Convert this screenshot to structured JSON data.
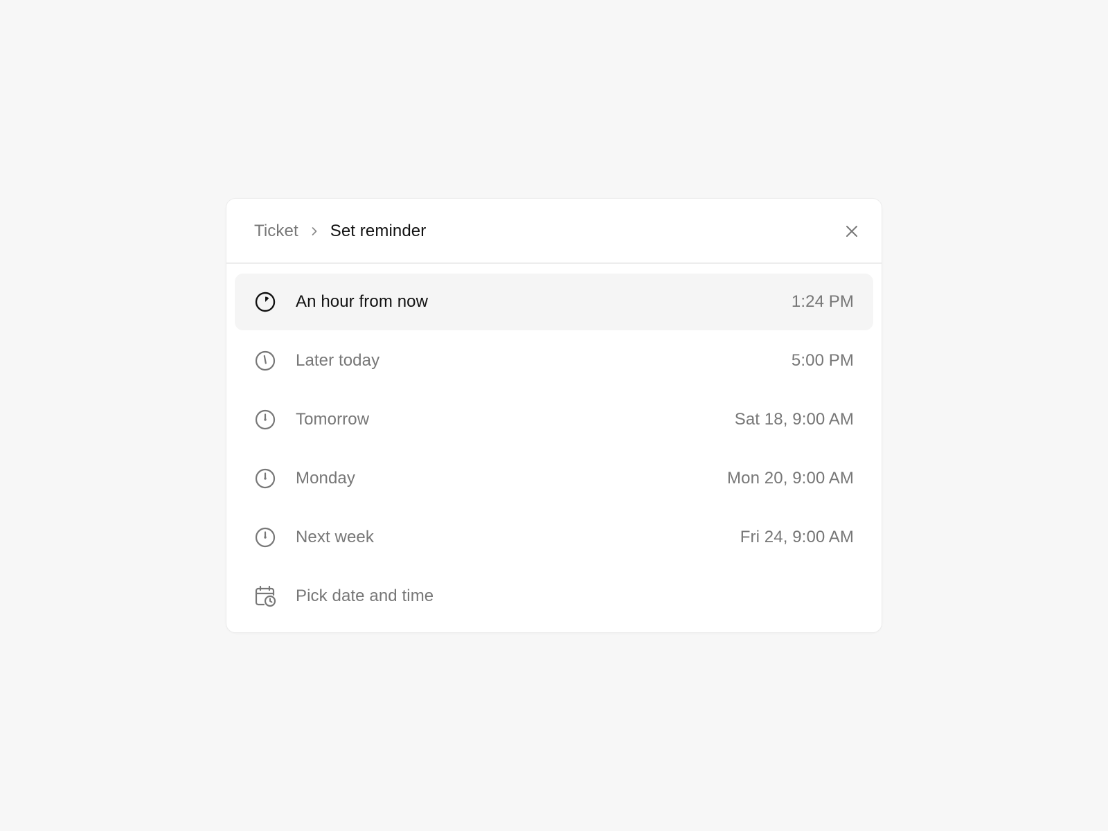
{
  "header": {
    "breadcrumb_parent": "Ticket",
    "breadcrumb_current": "Set reminder"
  },
  "icons": {
    "separator": "chevron-right-icon",
    "close": "close-icon",
    "clock": "clock-icon",
    "calendar": "calendar-clock-icon"
  },
  "colors": {
    "page_bg": "#f7f7f7",
    "panel_bg": "#ffffff",
    "active_row_bg": "#f5f5f5",
    "primary_text": "#111111",
    "secondary_text": "#777777"
  },
  "options": [
    {
      "label": "An hour from now",
      "value": "1:24 PM",
      "active": true
    },
    {
      "label": "Later today",
      "value": "5:00 PM",
      "active": false
    },
    {
      "label": "Tomorrow",
      "value": "Sat 18, 9:00 AM",
      "active": false
    },
    {
      "label": "Monday",
      "value": "Mon 20, 9:00 AM",
      "active": false
    },
    {
      "label": "Next week",
      "value": "Fri 24, 9:00 AM",
      "active": false
    },
    {
      "label": "Pick date and time",
      "value": "",
      "active": false
    }
  ]
}
